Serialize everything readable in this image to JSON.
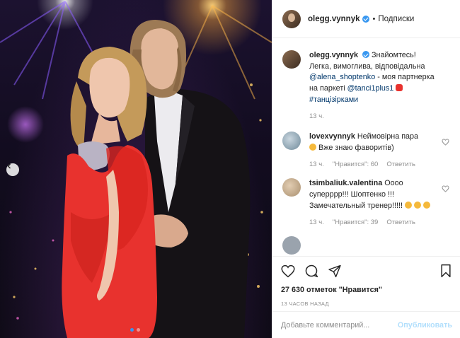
{
  "header": {
    "username": "olegg.vynnyk",
    "follow_label": "Подписки",
    "separator": "•"
  },
  "caption": {
    "username": "olegg.vynnyk",
    "text_part1": "Знайомтесь! Легка, вимоглива, відповідальна",
    "mention1": "@alena_shoptenko",
    "text_part2": "- моя партнерка на паркеті",
    "mention2": "@tanci1plus1",
    "hashtag": "#танцізірками",
    "time": "13 ч."
  },
  "comments": [
    {
      "username": "lovexvynnyk",
      "text_part1": "Неймовірна пара",
      "text_part2": "Вже знаю фаворитів)",
      "time": "13 ч.",
      "likes": "\"Нравится\": 60",
      "reply": "Ответить",
      "avatar_color": "#6f8a9a"
    },
    {
      "username": "tsimbaliuk.valentina",
      "text": "Оооо суперррр!!! Шоптенко !!! Замечательный тренер!!!!!",
      "time": "13 ч.",
      "likes": "\"Нравится\": 39",
      "reply": "Ответить",
      "avatar_color": "#a98f6f"
    }
  ],
  "actions": {
    "likes_count": "27 630 отметок",
    "likes_label": "\"Нравится\"",
    "timestamp": "13 часов назад"
  },
  "comment_box": {
    "placeholder": "Добавьте комментарий...",
    "publish_label": "Опубликовать"
  },
  "colors": {
    "verified": "#3897f0",
    "link": "#00376b",
    "dress": "#e8322e",
    "publish_disabled": "#b2dffc"
  },
  "icons": [
    "verified-badge-icon",
    "heart-icon",
    "comment-icon",
    "share-icon",
    "bookmark-icon",
    "chevron-left-icon",
    "heart-small-icon"
  ]
}
